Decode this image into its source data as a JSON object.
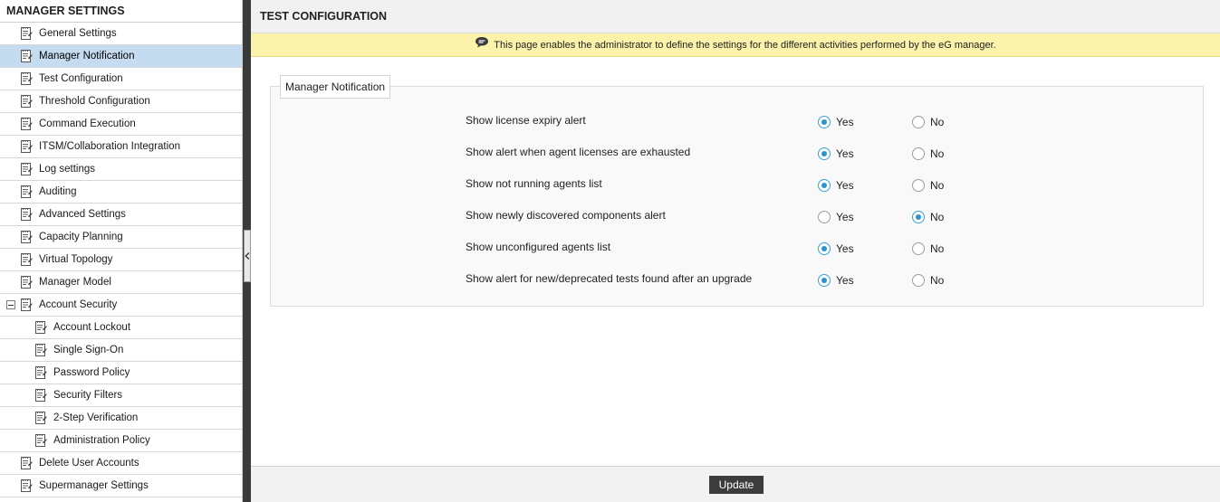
{
  "sidebar": {
    "title": "MANAGER SETTINGS",
    "items": [
      {
        "label": "General Settings",
        "level": 0,
        "active": false,
        "expanded": null
      },
      {
        "label": "Manager Notification",
        "level": 0,
        "active": true,
        "expanded": null
      },
      {
        "label": "Test Configuration",
        "level": 0,
        "active": false,
        "expanded": null
      },
      {
        "label": "Threshold Configuration",
        "level": 0,
        "active": false,
        "expanded": null
      },
      {
        "label": "Command Execution",
        "level": 0,
        "active": false,
        "expanded": null
      },
      {
        "label": "ITSM/Collaboration Integration",
        "level": 0,
        "active": false,
        "expanded": null
      },
      {
        "label": "Log settings",
        "level": 0,
        "active": false,
        "expanded": null
      },
      {
        "label": "Auditing",
        "level": 0,
        "active": false,
        "expanded": null
      },
      {
        "label": "Advanced Settings",
        "level": 0,
        "active": false,
        "expanded": null
      },
      {
        "label": "Capacity Planning",
        "level": 0,
        "active": false,
        "expanded": null
      },
      {
        "label": "Virtual Topology",
        "level": 0,
        "active": false,
        "expanded": null
      },
      {
        "label": "Manager Model",
        "level": 0,
        "active": false,
        "expanded": null
      },
      {
        "label": "Account Security",
        "level": 0,
        "active": false,
        "expanded": true
      },
      {
        "label": "Account Lockout",
        "level": 1,
        "active": false,
        "expanded": null
      },
      {
        "label": "Single Sign-On",
        "level": 1,
        "active": false,
        "expanded": null
      },
      {
        "label": "Password Policy",
        "level": 1,
        "active": false,
        "expanded": null
      },
      {
        "label": "Security Filters",
        "level": 1,
        "active": false,
        "expanded": null
      },
      {
        "label": "2-Step Verification",
        "level": 1,
        "active": false,
        "expanded": null
      },
      {
        "label": "Administration Policy",
        "level": 1,
        "active": false,
        "expanded": null
      },
      {
        "label": "Delete User Accounts",
        "level": 0,
        "active": false,
        "expanded": null
      },
      {
        "label": "Supermanager Settings",
        "level": 0,
        "active": false,
        "expanded": null
      }
    ]
  },
  "main": {
    "title": "TEST CONFIGURATION",
    "info_text": "This page enables the administrator to define the settings for the different activities performed by the eG manager.",
    "section_legend": "Manager Notification",
    "yes_label": "Yes",
    "no_label": "No",
    "settings": [
      {
        "label": "Show license expiry alert",
        "value": "Yes"
      },
      {
        "label": "Show alert when agent licenses are exhausted",
        "value": "Yes"
      },
      {
        "label": "Show not running agents list",
        "value": "Yes"
      },
      {
        "label": "Show newly discovered components alert",
        "value": "No"
      },
      {
        "label": "Show unconfigured agents list",
        "value": "Yes"
      },
      {
        "label": "Show alert for new/deprecated tests found after an upgrade",
        "value": "Yes"
      }
    ],
    "update_label": "Update"
  },
  "colors": {
    "active_item_bg": "#c5dcf0",
    "info_bar_bg": "#fbf3a9",
    "radio_accent": "#2a93d0",
    "button_bg": "#3c3c3c",
    "splitter": "#3a3a3a"
  },
  "icons": {
    "nav_item": "document-icon",
    "info": "speech-bubble-icon",
    "splitter": "chevron-left-icon",
    "tree_toggle": "collapse-minus-icon"
  }
}
